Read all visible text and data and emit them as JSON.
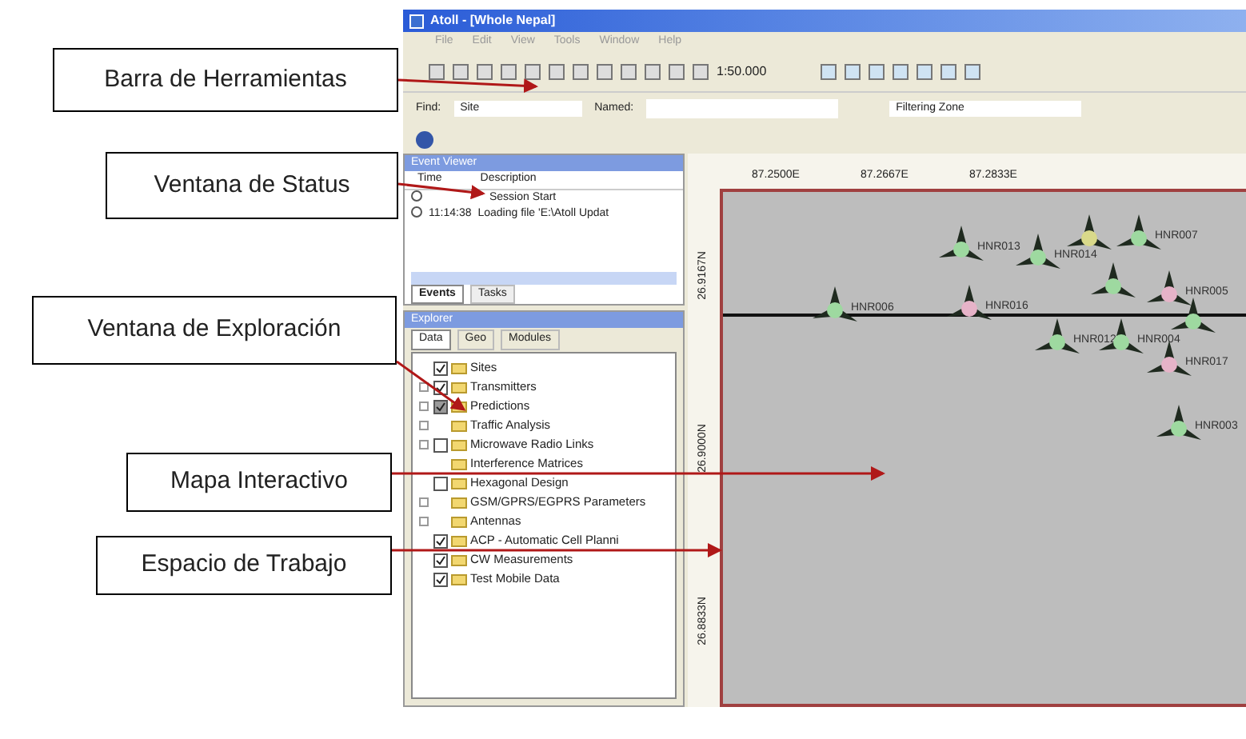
{
  "callouts": [
    {
      "text": "Barra de Herramientas"
    },
    {
      "text": "Ventana de Status"
    },
    {
      "text": "Ventana de Exploración"
    },
    {
      "text": "Mapa Interactivo"
    },
    {
      "text": "Espacio de Trabajo"
    }
  ],
  "window": {
    "title": "Atoll - [Whole Nepal]"
  },
  "menu": [
    "File",
    "Edit",
    "View",
    "Tools",
    "Window",
    "Help"
  ],
  "toolbar": {
    "scale": "1:50.000"
  },
  "find_bar": {
    "label": "Find:",
    "type": "Site",
    "named_label": "Named:",
    "filter": "Filtering Zone"
  },
  "event_viewer": {
    "title": "Event Viewer",
    "columns": [
      "Time",
      "Description"
    ],
    "rows": [
      {
        "time": "",
        "description": "Session Start"
      },
      {
        "time": "11:14:38",
        "description": "Loading file 'E:\\Atoll Updat"
      }
    ],
    "tabs": [
      {
        "label": "Events",
        "selected": true
      },
      {
        "label": "Tasks",
        "selected": false
      }
    ]
  },
  "explorer": {
    "title": "Explorer",
    "tabs": [
      {
        "label": "Data",
        "selected": true
      },
      {
        "label": "Geo",
        "selected": false
      },
      {
        "label": "Modules",
        "selected": false
      }
    ],
    "items": [
      {
        "label": "Sites",
        "expandable": false,
        "checked": true
      },
      {
        "label": "Transmitters",
        "expandable": true,
        "checked": true
      },
      {
        "label": "Predictions",
        "expandable": true,
        "checked": true,
        "partial": true
      },
      {
        "label": "Traffic Analysis",
        "expandable": true
      },
      {
        "label": "Microwave Radio Links",
        "expandable": true,
        "checked": false
      },
      {
        "label": "Interference Matrices",
        "expandable": false
      },
      {
        "label": "Hexagonal Design",
        "expandable": false,
        "checked": false
      },
      {
        "label": "GSM/GPRS/EGPRS Parameters",
        "expandable": true
      },
      {
        "label": "Antennas",
        "expandable": true
      },
      {
        "label": "ACP - Automatic Cell Planni",
        "expandable": false,
        "checked": true
      },
      {
        "label": "CW Measurements",
        "expandable": false,
        "checked": true
      },
      {
        "label": "Test Mobile Data",
        "expandable": false,
        "checked": true
      }
    ]
  },
  "map": {
    "x_ticks": [
      "87.2500E",
      "87.2667E",
      "87.2833E"
    ],
    "y_ticks": [
      "26.9167N",
      "26.9000N",
      "26.8833N"
    ],
    "sites": [
      {
        "label": "HNR006",
        "color": "#9ed9a0"
      },
      {
        "label": "HNR013",
        "color": "#9ed9a0"
      },
      {
        "label": "HNR014",
        "color": "#9ed9a0"
      },
      {
        "color": "#d9d98a"
      },
      {
        "label": "HNR007",
        "color": "#9ed9a0"
      },
      {
        "label": "HNR016",
        "color": "#e6b3c8"
      },
      {
        "color": "#9ed9a0"
      },
      {
        "label": "HNR005",
        "color": "#e6b3c8"
      },
      {
        "color": "#9ed9a0"
      },
      {
        "label": "HNR012",
        "color": "#9ed9a0"
      },
      {
        "label": "HNR004",
        "color": "#9ed9a0"
      },
      {
        "label": "HNR017",
        "color": "#e6b3c8"
      },
      {
        "label": "HNR003",
        "color": "#9ed9a0"
      }
    ]
  }
}
